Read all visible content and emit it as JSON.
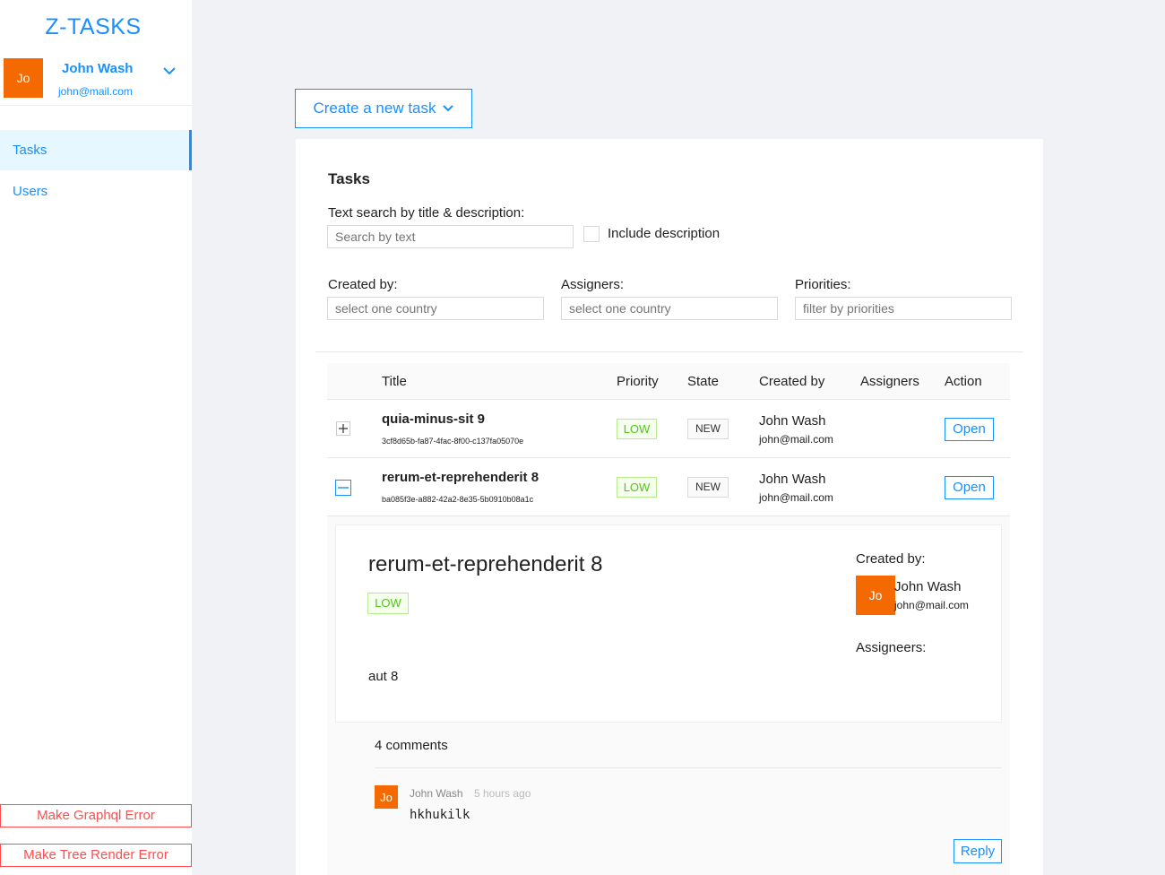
{
  "app": {
    "title": "Z-TASKS"
  },
  "user": {
    "initials": "Jo",
    "name": "John Wash",
    "email": "john@mail.com"
  },
  "nav": {
    "tasks": "Tasks",
    "users": "Users"
  },
  "footer_buttons": {
    "graphql_error": "Make Graphql Error",
    "tree_error": "Make Tree Render Error"
  },
  "create_button": "Create a new task",
  "tasks_panel": {
    "title": "Tasks",
    "search_label": "Text search by title & description",
    "search_placeholder": "Search by text",
    "include_description": "Include description",
    "created_by_label": "Created by",
    "created_by_placeholder": "select one country",
    "assigners_label": "Assigners",
    "assigners_placeholder": "select one country",
    "priorities_label": "Priorities",
    "priorities_placeholder": "filter by priorities"
  },
  "table": {
    "columns": [
      "Title",
      "Priority",
      "State",
      "Created by",
      "Assigners",
      "Action"
    ],
    "rows": [
      {
        "title": "quia-minus-sit 9",
        "id": "3cf8d65b-fa87-4fac-8f00-c137fa05070e",
        "priority": "LOW",
        "state": "NEW",
        "creator_name": "John Wash",
        "creator_email": "john@mail.com",
        "action": "Open",
        "expanded": false
      },
      {
        "title": "rerum-et-reprehenderit 8",
        "id": "ba085f3e-a882-42a2-8e35-5b0910b08a1c",
        "priority": "LOW",
        "state": "NEW",
        "creator_name": "John Wash",
        "creator_email": "john@mail.com",
        "action": "Open",
        "expanded": true
      }
    ]
  },
  "detail": {
    "title": "rerum-et-reprehenderit 8",
    "priority": "LOW",
    "description": "aut 8",
    "created_by_label": "Created by:",
    "creator_initials": "Jo",
    "creator_name": "John Wash",
    "creator_email": "john@mail.com",
    "assigneers_label": "Assigneers:"
  },
  "comments": {
    "count_label": "4 comments",
    "items": [
      {
        "initials": "Jo",
        "author": "John Wash",
        "time": "5 hours ago",
        "text": "hkhukilk"
      }
    ],
    "reply_label": "Reply"
  },
  "colors": {
    "primary": "#1890ff",
    "avatar": "#f56a00",
    "danger": "#ff4d4f",
    "low_tag": "#52c41a"
  }
}
